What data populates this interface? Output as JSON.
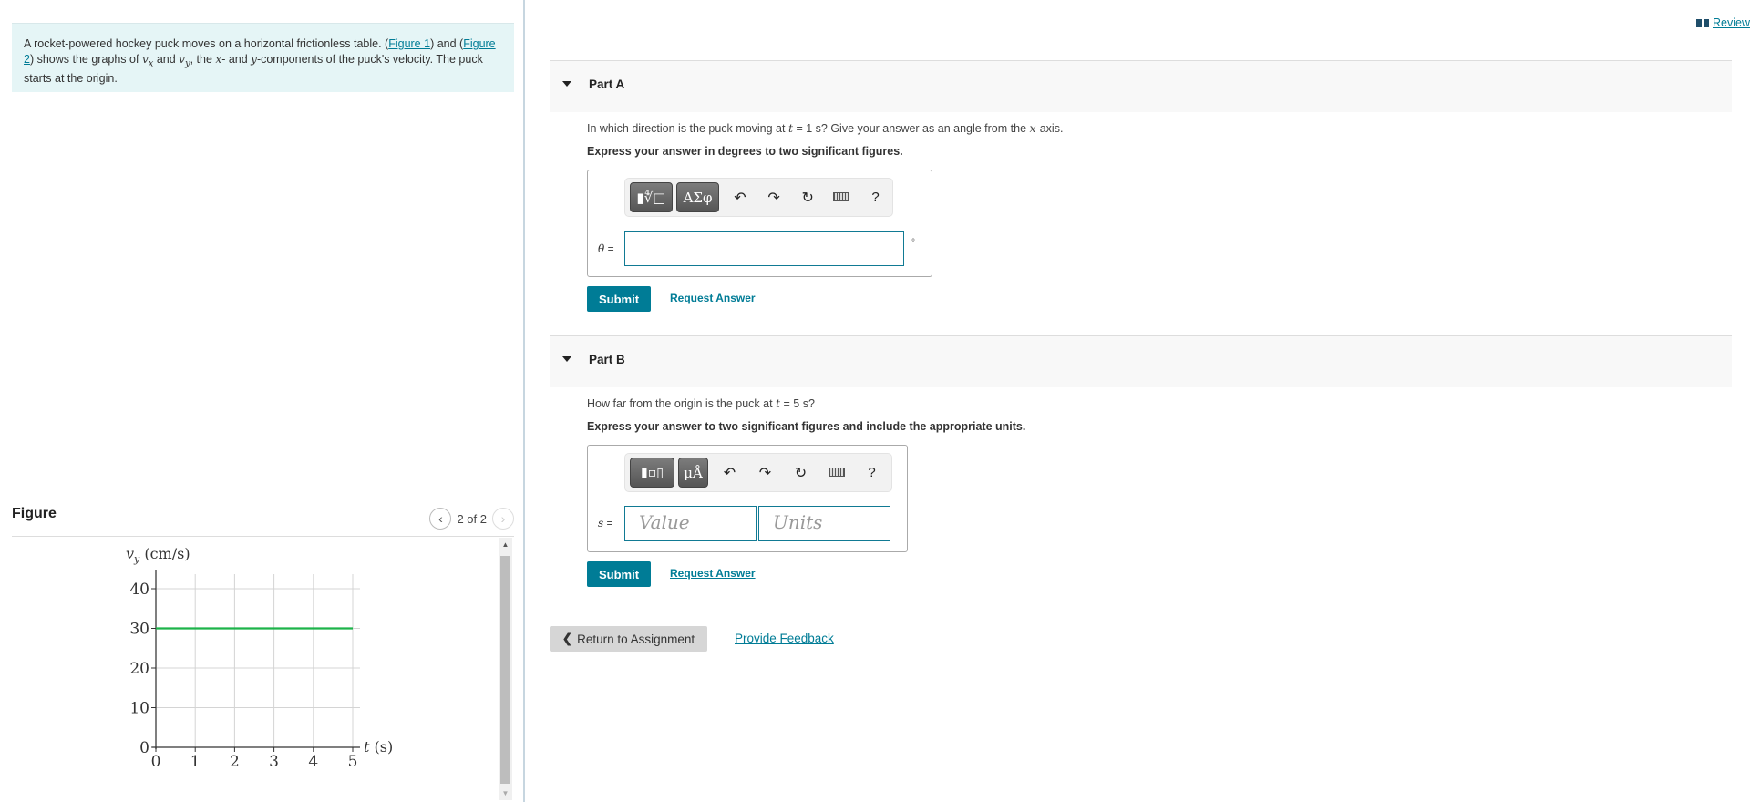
{
  "intro": {
    "text_1": "A rocket-powered hockey puck moves on a horizontal frictionless table. (",
    "figure1_link": "Figure 1",
    "text_2": ") and (",
    "figure2_link": "Figure 2",
    "text_3": ") shows the graphs of ",
    "vx": "v",
    "vx_sub": "x",
    "text_4": " and ",
    "vy": "v",
    "vy_sub": "y",
    "text_5": ", the ",
    "x": "x",
    "text_6": "- and ",
    "y": "y",
    "text_7": "-components of the puck's velocity. The puck starts at the origin."
  },
  "figure": {
    "title": "Figure",
    "pager": "2 of 2",
    "prev_icon": "chevron-left-icon",
    "next_icon": "chevron-right-icon"
  },
  "chart_data": {
    "type": "line",
    "title": "",
    "ylabel": "v_y (cm/s)",
    "ylabel_main": "v",
    "ylabel_sub": "y",
    "ylabel_unit": " (cm/s)",
    "xlabel_var": "t",
    "xlabel_unit": " (s)",
    "xlim": [
      0,
      5
    ],
    "ylim": [
      0,
      40
    ],
    "xticks": [
      "0",
      "1",
      "2",
      "3",
      "4",
      "5"
    ],
    "yticks": [
      "0",
      "10",
      "20",
      "30",
      "40"
    ],
    "grid": true,
    "series": [
      {
        "name": "v_y",
        "color": "#1db34a",
        "x": [
          0,
          5
        ],
        "y": [
          30,
          30
        ]
      }
    ]
  },
  "header": {
    "review_label": "Review",
    "review_icon": "book-icon"
  },
  "partA": {
    "label": "Part A",
    "question_1": "In which direction is the puck moving at ",
    "question_t": "t",
    "question_2": " = 1 s? Give your answer as an angle from the ",
    "question_x": "x",
    "question_3": "-axis.",
    "instruction": "Express your answer in degrees to two significant figures.",
    "toolbar": {
      "template_btn": "▮∜□",
      "greek_btn": "ΑΣφ",
      "undo_icon": "↶",
      "redo_icon": "↷",
      "reset_icon": "↻",
      "help": "?"
    },
    "var_label": "θ",
    "eq": " =",
    "unit": "°",
    "value": "",
    "submit": "Submit",
    "request": "Request Answer"
  },
  "partB": {
    "label": "Part B",
    "question_1": "How far from the origin is the puck at ",
    "question_t": "t",
    "question_2": " = 5 s?",
    "instruction": "Express your answer to two significant figures and include the appropriate units.",
    "toolbar": {
      "template_btn": "▮▫▯",
      "units_btn": "μÅ",
      "undo_icon": "↶",
      "redo_icon": "↷",
      "reset_icon": "↻",
      "help": "?"
    },
    "var_label": "s",
    "eq": " =",
    "value_placeholder": "Value",
    "units_placeholder": "Units",
    "submit": "Submit",
    "request": "Request Answer"
  },
  "footer": {
    "return_label": "Return to Assignment",
    "feedback_label": "Provide Feedback"
  }
}
